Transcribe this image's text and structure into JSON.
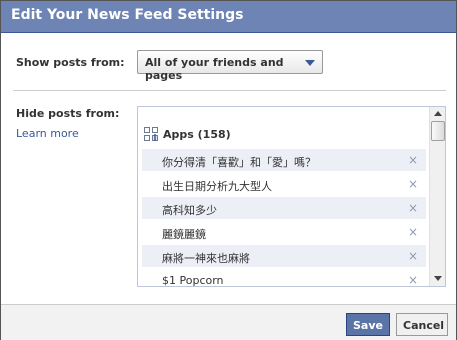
{
  "dialog": {
    "title": "Edit Your News Feed Settings"
  },
  "show_posts": {
    "label": "Show posts from:",
    "selected": "All of your friends and pages"
  },
  "hide_posts": {
    "label": "Hide posts from:",
    "learn_more": "Learn more",
    "group": {
      "icon": "apps-icon",
      "label": "Apps (158)"
    },
    "items": [
      {
        "label": "你分得清「喜歡」和「愛」嗎？",
        "remove": "×"
      },
      {
        "label": "出生日期分析九大型人",
        "remove": "×"
      },
      {
        "label": "高科知多少",
        "remove": "×"
      },
      {
        "label": "麗鏡麗鏡",
        "remove": "×"
      },
      {
        "label": "麻將一神來也麻將",
        "remove": "×"
      },
      {
        "label": "$1 Popcorn",
        "remove": "×"
      }
    ]
  },
  "footer": {
    "save": "Save",
    "cancel": "Cancel"
  },
  "colors": {
    "title_bar": "#6d84b4",
    "link": "#3b5998",
    "save_button": "#5b74a8",
    "row_shade": "#eceff5"
  }
}
